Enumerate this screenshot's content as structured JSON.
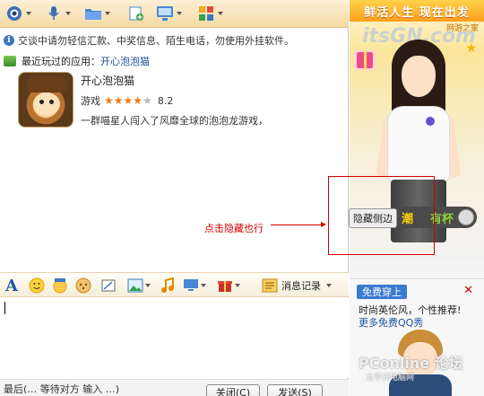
{
  "notice": {
    "text": "交谈中请勿轻信汇款、中奖信息、陌生电话，勿使用外挂软件。"
  },
  "recent_app": {
    "label": "最近玩过的应用：",
    "link": "开心泡泡猫",
    "title": "开心泡泡猫",
    "category": "游戏",
    "rating": 4,
    "rating_max": 5,
    "score": "8.2",
    "description": "一群喵星人闯入了风靡全球的泡泡龙游戏，"
  },
  "annotation": {
    "text": "点击隐藏也行"
  },
  "hide_sidebar_button": "隐藏侧边",
  "edit_toolbar": {
    "history_label": "消息记录"
  },
  "bottom": {
    "status": "最后(… 等待对方 输入 …)",
    "close_label": "关闭(C)",
    "send_label": "发送(S)"
  },
  "ad_top": {
    "banner": "鲜活人生  现在出发",
    "sub": "网游之家",
    "watermark": "itsGN.com",
    "btn_text_1": "潮",
    "btn_text_2": "有杯"
  },
  "ad_bottom": {
    "tag": "免费穿上",
    "close": "✕",
    "line1": "时尚英伦风，个性推荐!",
    "line2": "更多免费QQ秀",
    "watermark": "PConline 论坛",
    "watermark_sub": "太平洋电脑网"
  },
  "colors": {
    "annotation": "#d40000",
    "link": "#1e50a2",
    "accent": "#f27a1a"
  }
}
